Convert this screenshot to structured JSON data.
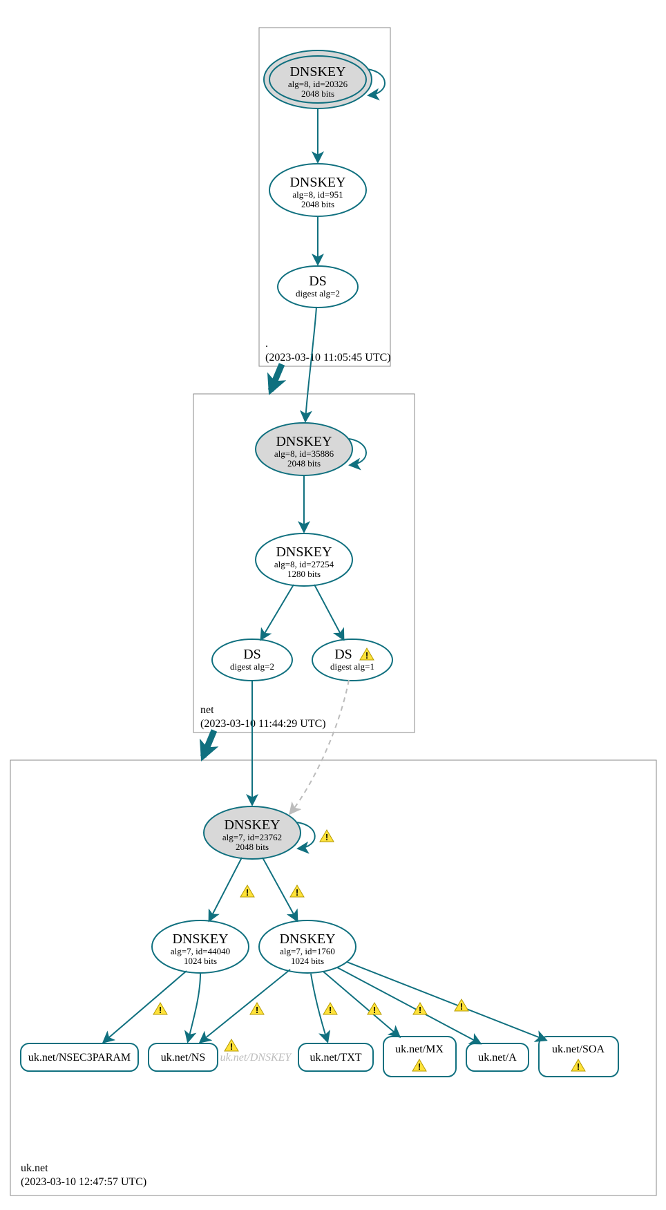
{
  "colors": {
    "stroke": "#10707f",
    "node_grey": "#d8d8d8",
    "warn_fill": "#ffe23a",
    "warn_stroke": "#b59a00",
    "dashed_grey": "#bcbcbc"
  },
  "zones": {
    "root": {
      "label": ".",
      "timestamp": "(2023-03-10 11:05:45 UTC)"
    },
    "net": {
      "label": "net",
      "timestamp": "(2023-03-10 11:44:29 UTC)"
    },
    "uknet": {
      "label": "uk.net",
      "timestamp": "(2023-03-10 12:47:57 UTC)"
    }
  },
  "nodes": {
    "root_ksk": {
      "title": "DNSKEY",
      "sub1": "alg=8, id=20326",
      "sub2": "2048 bits"
    },
    "root_zsk": {
      "title": "DNSKEY",
      "sub1": "alg=8, id=951",
      "sub2": "2048 bits"
    },
    "root_ds": {
      "title": "DS",
      "sub1": "digest alg=2",
      "sub2": ""
    },
    "net_ksk": {
      "title": "DNSKEY",
      "sub1": "alg=8, id=35886",
      "sub2": "2048 bits"
    },
    "net_zsk": {
      "title": "DNSKEY",
      "sub1": "alg=8, id=27254",
      "sub2": "1280 bits"
    },
    "net_ds2": {
      "title": "DS",
      "sub1": "digest alg=2",
      "sub2": ""
    },
    "net_ds1": {
      "title": "DS",
      "sub1": "digest alg=1",
      "sub2": ""
    },
    "uk_ksk": {
      "title": "DNSKEY",
      "sub1": "alg=7, id=23762",
      "sub2": "2048 bits"
    },
    "uk_zsk1": {
      "title": "DNSKEY",
      "sub1": "alg=7, id=44040",
      "sub2": "1024 bits"
    },
    "uk_zsk2": {
      "title": "DNSKEY",
      "sub1": "alg=7, id=1760",
      "sub2": "1024 bits"
    }
  },
  "leaves": {
    "nsec3": "uk.net/NSEC3PARAM",
    "ns": "uk.net/NS",
    "dnskey": "uk.net/DNSKEY",
    "txt": "uk.net/TXT",
    "mx": "uk.net/MX",
    "a": "uk.net/A",
    "soa": "uk.net/SOA"
  }
}
